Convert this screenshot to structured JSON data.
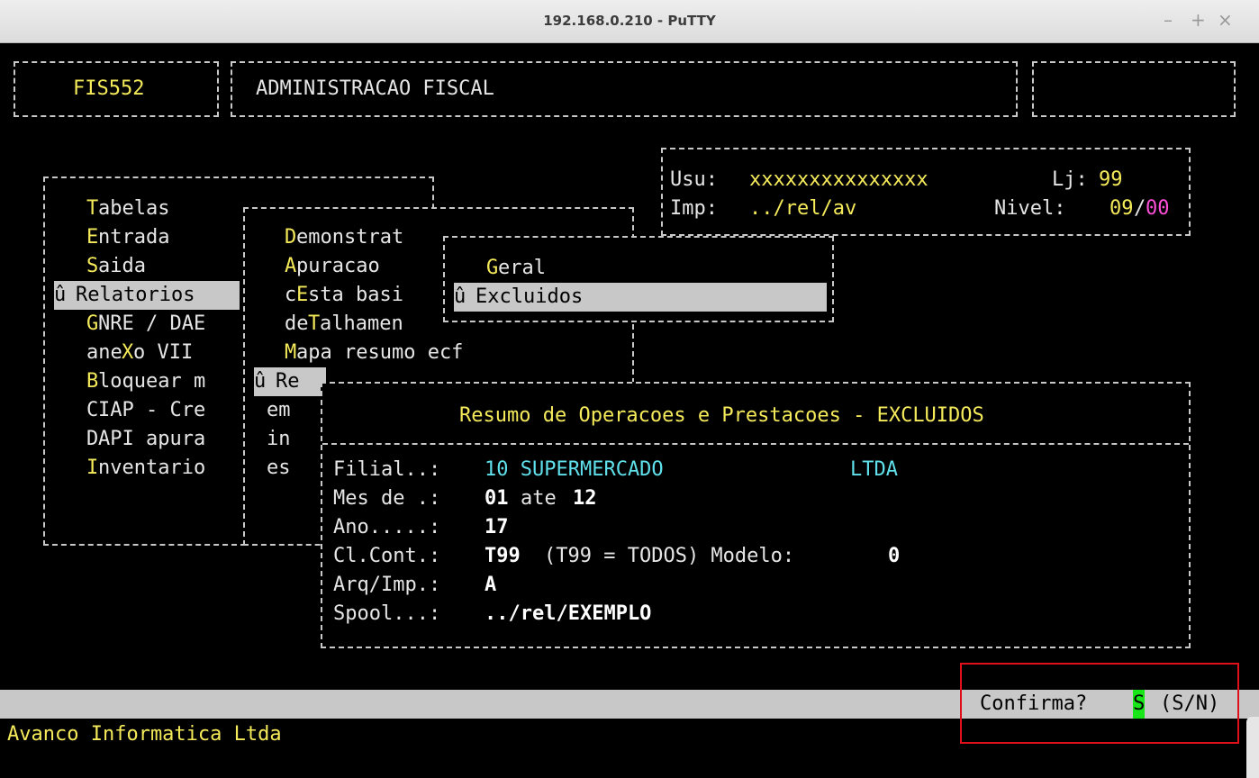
{
  "window": {
    "title": "192.168.0.210 - PuTTY",
    "controls": {
      "minimize": "–",
      "maximize": "+",
      "close": "×"
    }
  },
  "header": {
    "program": "FIS552",
    "system": "ADMINISTRACAO FISCAL"
  },
  "user_info": {
    "usu_label": "Usu:",
    "usu_value": "xxxxxxxxxxxxxxx",
    "lj_label": "Lj:",
    "lj_value": "99",
    "imp_label": "Imp:",
    "imp_value": "../rel/av",
    "nivel_label": "Nivel:",
    "nivel_a": "09",
    "nivel_sep": "/",
    "nivel_b": "00"
  },
  "main_menu": {
    "marker": "û",
    "items": [
      {
        "hot": "T",
        "rest": "abelas"
      },
      {
        "hot": "E",
        "rest": "ntrada"
      },
      {
        "hot": "S",
        "rest": "aida"
      },
      {
        "label": "Relatorios"
      },
      {
        "pre": "",
        "hot": "G",
        "rest": "NRE / DAE"
      },
      {
        "pre": "ane",
        "hot": "X",
        "rest": "o VII"
      },
      {
        "pre": "",
        "hot": "B",
        "rest": "loquear m"
      },
      {
        "pre": "",
        "hot": "C",
        "rest": "IAP - Cre"
      },
      {
        "pre": "",
        "hot": "D",
        "rest": "API apura"
      },
      {
        "pre": "",
        "hot": "I",
        "rest": "nventario"
      }
    ]
  },
  "sub_menu": {
    "items": [
      {
        "pre": "",
        "hot": "D",
        "rest": "emonstrat"
      },
      {
        "pre": "",
        "hot": "A",
        "rest": "puracao"
      },
      {
        "pre": "c",
        "hot": "E",
        "rest": "sta basi"
      },
      {
        "pre": "de",
        "hot": "T",
        "rest": "alhamen"
      },
      {
        "pre": "",
        "hot": "M",
        "rest": "apa resumo ecf"
      },
      {
        "label": "Re"
      },
      {
        "pre": "",
        "hot": "",
        "rest": "em"
      },
      {
        "pre": "",
        "hot": "",
        "rest": "in"
      },
      {
        "pre": "",
        "hot": "",
        "rest": "es"
      }
    ]
  },
  "sub_sub_menu": {
    "items": [
      {
        "hot": "G",
        "rest": "eral"
      },
      {
        "label": "Excluidos"
      }
    ]
  },
  "dialog": {
    "title": "Resumo de Operacoes e Prestacoes - EXCLUIDOS",
    "filial_label": "Filial..:",
    "filial_value": "10 SUPERMERCADO",
    "filial_suffix": "LTDA",
    "mes_label": "Mes de .:",
    "mes_from": "01",
    "mes_ate": "ate",
    "mes_to": "12",
    "ano_label": "Ano.....:",
    "ano_value": "17",
    "clcont_label": "Cl.Cont.:",
    "clcont_value": "T99",
    "clcont_note": "(T99 = TODOS) Modelo:",
    "modelo_value": "0",
    "arq_label": "Arq/Imp.:",
    "arq_value": "A",
    "spool_label": "Spool...:",
    "spool_value": "../rel/EXEMPLO"
  },
  "status": {
    "prompt": "Confirma?",
    "answer": "S",
    "options": "(S/N)"
  },
  "footer": {
    "company": "Avanco Informatica Ltda"
  },
  "colors": {
    "terminal_bg": "#000000",
    "yellow": "#f5ea5a",
    "cyan": "#5fe0ea",
    "magenta": "#ff4fd8",
    "highlight_bar": "#c8c8c8",
    "answer_green": "#19e619",
    "annotation_red": "#e0101a"
  }
}
